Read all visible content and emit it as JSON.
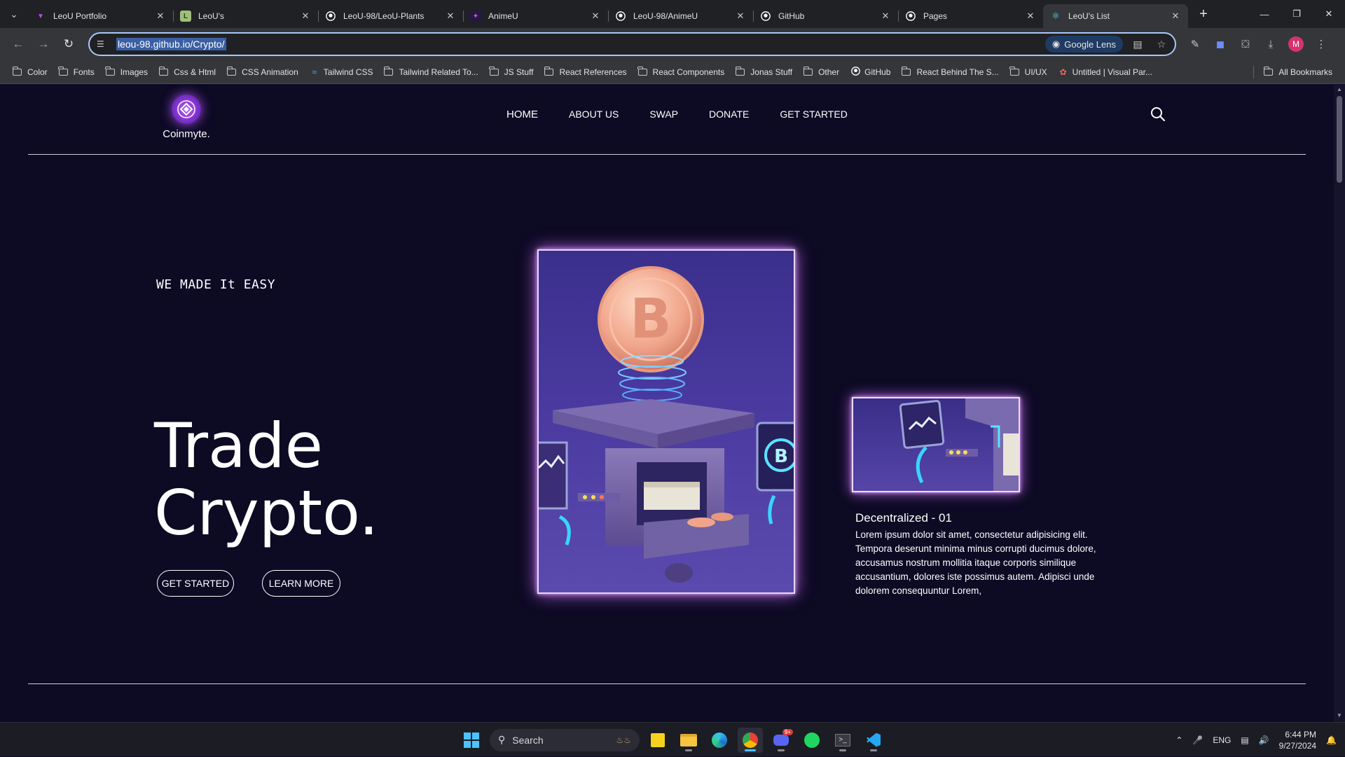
{
  "browser": {
    "tabs": [
      {
        "title": "LeoU Portfolio",
        "icon": "vite-icon",
        "color": "#a855f7",
        "active": false
      },
      {
        "title": "LeoU's",
        "icon": "image-favicon",
        "color": "#9fbf7a",
        "active": false
      },
      {
        "title": "LeoU-98/LeoU-Plants",
        "icon": "github-icon",
        "color": "#ffffff",
        "active": false
      },
      {
        "title": "AnimeU",
        "icon": "animeu-favicon",
        "color": "#7c3aed",
        "active": false
      },
      {
        "title": "LeoU-98/AnimeU",
        "icon": "github-icon",
        "color": "#ffffff",
        "active": false
      },
      {
        "title": "GitHub",
        "icon": "github-icon",
        "color": "#ffffff",
        "active": false
      },
      {
        "title": "Pages",
        "icon": "github-icon",
        "color": "#ffffff",
        "active": false
      },
      {
        "title": "LeoU's List",
        "icon": "react-icon",
        "color": "#61dafb",
        "active": true
      }
    ],
    "url": "leou-98.github.io/Crypto/",
    "lens_label": "Google Lens",
    "profile_initial": "M",
    "bookmarks": [
      {
        "label": "Color",
        "icon": "folder"
      },
      {
        "label": "Fonts",
        "icon": "folder"
      },
      {
        "label": "Images",
        "icon": "folder"
      },
      {
        "label": "Css & Html",
        "icon": "folder"
      },
      {
        "label": "CSS Animation",
        "icon": "folder"
      },
      {
        "label": "Tailwind CSS",
        "icon": "tailwind"
      },
      {
        "label": "Tailwind Related To...",
        "icon": "folder"
      },
      {
        "label": "JS Stuff",
        "icon": "folder"
      },
      {
        "label": "React References",
        "icon": "folder"
      },
      {
        "label": "React Components",
        "icon": "folder"
      },
      {
        "label": "Jonas Stuff",
        "icon": "folder"
      },
      {
        "label": "Other",
        "icon": "folder"
      },
      {
        "label": "GitHub",
        "icon": "github"
      },
      {
        "label": "React Behind The S...",
        "icon": "folder"
      },
      {
        "label": "UI/UX",
        "icon": "folder"
      },
      {
        "label": "Untitled | Visual Par...",
        "icon": "visual"
      }
    ],
    "all_bookmarks": "All Bookmarks"
  },
  "site": {
    "logo_text": "Coinmyte.",
    "nav": [
      "HOME",
      "ABOUT US",
      "SWAP",
      "DONATE",
      "GET STARTED"
    ],
    "kicker": "WE MADE It EASY",
    "headline_line1": "Trade",
    "headline_line2": "Crypto.",
    "cta_primary": "GET STARTED",
    "cta_secondary": "LEARN MORE",
    "feature_title": "Decentralized - 01",
    "feature_body": "Lorem ipsum dolor sit amet, consectetur adipisicing elit. Tempora deserunt minima minus corrupti ducimus dolore, accusamus nostrum mollitia itaque corporis similique accusantium, dolores iste possimus autem. Adipisci unde dolorem consequuntur Lorem,",
    "colors": {
      "background": "#0d0a24",
      "glow": "#c76cf6",
      "logo": "#a64ff0"
    }
  },
  "taskbar": {
    "search_label": "Search",
    "discord_badge": "9+",
    "language": "ENG",
    "time": "6:44 PM",
    "date": "9/27/2024"
  }
}
